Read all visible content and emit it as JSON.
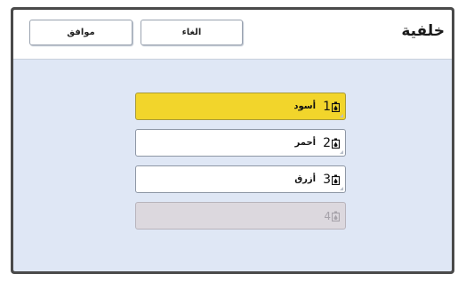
{
  "header": {
    "title": "خلفية",
    "ok_label": "موافق",
    "cancel_label": "الغاء"
  },
  "items": [
    {
      "number": "1",
      "label": "أسود",
      "state": "selected"
    },
    {
      "number": "2",
      "label": "أحمر",
      "state": "normal"
    },
    {
      "number": "3",
      "label": "أزرق",
      "state": "normal"
    },
    {
      "number": "4",
      "label": "",
      "state": "disabled"
    }
  ],
  "colors": {
    "selected": "#f2d52b",
    "background": "#dfe7f5",
    "frame": "#4a4a4a",
    "disabled": "#dcd8de"
  },
  "icons": {
    "ink_drum": "ink-bottle-icon"
  }
}
